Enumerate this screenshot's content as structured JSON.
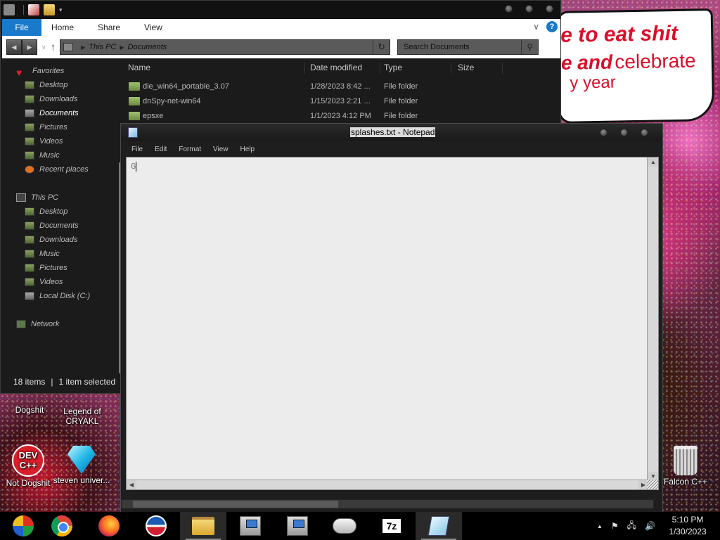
{
  "desktop": {
    "meme": {
      "line1": "e to eat shit",
      "line2_bold": "e and",
      "line2_normal": "celebrate",
      "line3": "y year"
    },
    "icons": [
      {
        "label": "Dogshit"
      },
      {
        "label": "Legend of CRYAKL"
      },
      {
        "label": "Not Dogshit",
        "badge_top": "DEV",
        "badge_bottom": "C++"
      },
      {
        "label": "steven univer..."
      },
      {
        "label": "Falcon C++"
      }
    ]
  },
  "explorer": {
    "ribbon": {
      "file": "File",
      "tabs": [
        "Home",
        "Share",
        "View"
      ],
      "help": "?"
    },
    "address": {
      "segments": [
        "This PC",
        "Documents"
      ],
      "search_placeholder": "Search Documents"
    },
    "nav": {
      "favorites": {
        "title": "Favorites",
        "items": [
          "Desktop",
          "Downloads",
          "Documents",
          "Pictures",
          "Videos",
          "Music",
          "Recent places"
        ]
      },
      "this_pc": {
        "title": "This PC",
        "items": [
          "Desktop",
          "Documents",
          "Downloads",
          "Music",
          "Pictures",
          "Videos",
          "Local Disk (C:)"
        ]
      },
      "network": "Network"
    },
    "columns": [
      "Name",
      "Date modified",
      "Type",
      "Size"
    ],
    "files": [
      {
        "name": "die_win64_portable_3.07",
        "date": "1/28/2023 8:42 ...",
        "type": "File folder"
      },
      {
        "name": "dnSpy-net-win64",
        "date": "1/15/2023 2:21 ...",
        "type": "File folder"
      },
      {
        "name": "epsxe",
        "date": "1/1/2023 4:12 PM",
        "type": "File folder"
      }
    ],
    "status": {
      "items": "18 items",
      "selected": "1 item selected"
    }
  },
  "notepad": {
    "title": "splashes.txt - Notepad",
    "menu": [
      "File",
      "Edit",
      "Format",
      "View",
      "Help"
    ],
    "content": "G"
  },
  "taskbar": {
    "apps": [
      "start",
      "chrome",
      "firefox",
      "obama",
      "file-explorer",
      "installer-1",
      "installer-2",
      "gamepad",
      "7-zip",
      "notepad"
    ],
    "seven_zip_label": "7z",
    "tray": {
      "show_hidden": "▲",
      "time": "5:10 PM",
      "date": "1/30/2023"
    }
  },
  "colors": {
    "ribbon_file_accent": "#1979ca",
    "meme_red": "#d8102a",
    "window_dark": "#1b1b1b"
  }
}
